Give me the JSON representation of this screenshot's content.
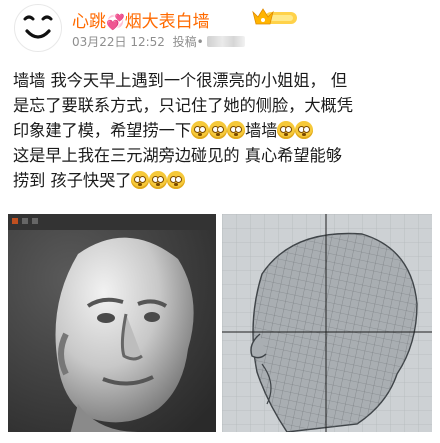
{
  "post": {
    "author": "心跳",
    "author_suffix": "烟大表白墙",
    "heart_icon": "💞",
    "timestamp": "03月22日 12:52",
    "source_prefix": "投稿•",
    "text_lines": [
      "墙墙 我今天早上遇到一个很漂亮的小姐姐， 但",
      "是忘了要联系方式，只记住了她的侧脸，大概凭",
      "印象建了模，希望捞一下",
      "这是早上我在三元湖旁边碰见的 真心希望能够",
      "捞到 孩子快哭了"
    ],
    "line3_mid": "墙墙",
    "emoji_name": "pleading-face",
    "images": [
      {
        "name": "sculpt-render-image",
        "description_icon": "3d-head-render"
      },
      {
        "name": "wireframe-mesh-image",
        "description_icon": "3d-wireframe-side"
      }
    ]
  },
  "colors": {
    "author": "#ff6a00",
    "meta": "#8e8e8e",
    "text": "#1a1a1a",
    "emoji": "#f6c93a"
  }
}
